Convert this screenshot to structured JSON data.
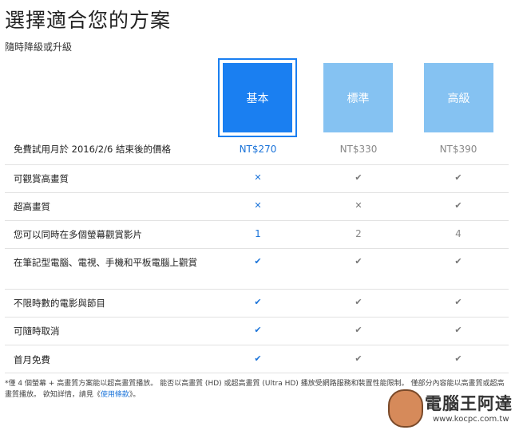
{
  "title": "選擇適合您的方案",
  "subtitle": "隨時降級或升級",
  "plans": [
    {
      "name": "基本",
      "selected": true
    },
    {
      "name": "標準",
      "selected": false
    },
    {
      "name": "高級",
      "selected": false
    }
  ],
  "rows": [
    {
      "label": "免費試用月於 2016/2/6 結束後的價格",
      "values": [
        "NT$270",
        "NT$330",
        "NT$390"
      ]
    },
    {
      "label": "可觀賞高畫質",
      "values": [
        "✕",
        "✔",
        "✔"
      ]
    },
    {
      "label": "超高畫質",
      "values": [
        "✕",
        "✕",
        "✔"
      ]
    },
    {
      "label": "您可以同時在多個螢幕觀賞影片",
      "values": [
        "1",
        "2",
        "4"
      ]
    },
    {
      "label": "在筆記型電腦、電視、手機和平板電腦上觀賞",
      "values": [
        "✔",
        "✔",
        "✔"
      ]
    },
    {
      "label": "不限時數的電影與節目",
      "values": [
        "✔",
        "✔",
        "✔"
      ]
    },
    {
      "label": "可隨時取消",
      "values": [
        "✔",
        "✔",
        "✔"
      ]
    },
    {
      "label": "首月免費",
      "values": [
        "✔",
        "✔",
        "✔"
      ]
    }
  ],
  "footnote": {
    "text": "*僅 4 個螢幕 + 高畫質方案能以超高畫質播放。 能否以高畫質 (HD) 或超高畫質 (Ultra HD) 播放受網路服務和裝置性能限制。 僅部分內容能以高畫質或超高畫質播放。 欲知詳情，請見《",
    "link": "使用條款",
    "end": "》。"
  },
  "watermark": {
    "name": "電腦王阿達",
    "url": "www.kocpc.com.tw"
  },
  "colors": {
    "selected": "#1a7ff1",
    "unselected": "#85c2f2",
    "accent_text": "#1a73d9"
  }
}
